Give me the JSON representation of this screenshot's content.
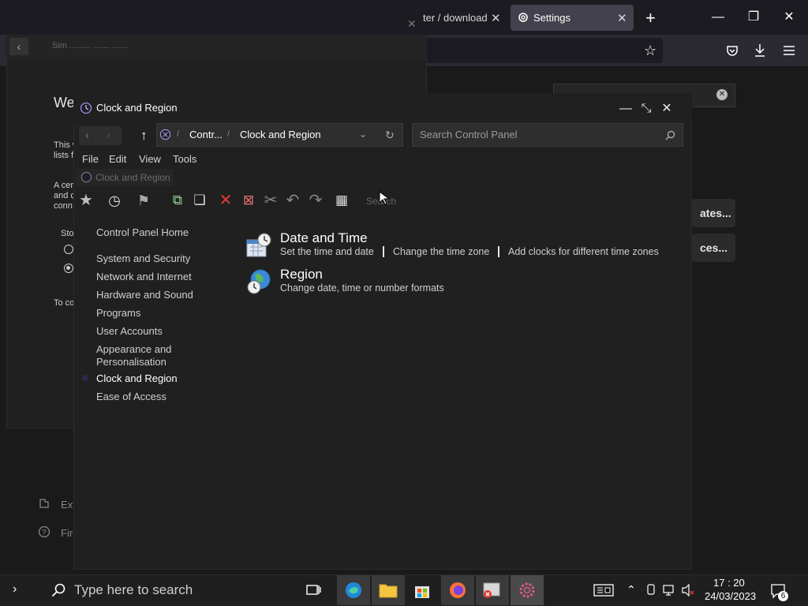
{
  "browser": {
    "tab_download": "ter / download",
    "tab_settings": "Settings",
    "tab_close": "✕",
    "new_tab": "+"
  },
  "background_dialog": {
    "crumb": "Sim ......... ....... ......",
    "heading": "We",
    "text1": "This w",
    "text1b": "lists f",
    "text2": "A cer",
    "text2b": "and c",
    "text2c": "conn",
    "label_sto": "Sto",
    "text3": "To co",
    "card1": "ates...",
    "card2": "ces...",
    "link_ext": "Ext",
    "link_fir": "Fir"
  },
  "window": {
    "title": "Clock and Region",
    "address": {
      "part1": "Contr...",
      "sep": "/",
      "part2": "Clock and Region"
    },
    "search_placeholder": "Search Control Panel",
    "menu": [
      "File",
      "Edit",
      "View",
      "Tools"
    ],
    "overlay_label": "Clock and Region",
    "toolbar_search": "Search",
    "sidebar": {
      "home": "Control Panel Home",
      "items": [
        "System and Security",
        "Network and Internet",
        "Hardware and Sound",
        "Programs",
        "User Accounts",
        "Appearance and",
        "Personalisation",
        "Clock and Region",
        "Ease of Access"
      ]
    },
    "categories": [
      {
        "title": "Date and Time",
        "links": [
          "Set the time and date",
          "Change the time zone",
          "Add clocks for different time zones"
        ]
      },
      {
        "title": "Region",
        "links": [
          "Change date, time or number formats"
        ]
      }
    ]
  },
  "taskbar": {
    "search_text": "Type here to search",
    "time": "17 : 20",
    "date": "24/03/2023",
    "notif_count": "6"
  }
}
